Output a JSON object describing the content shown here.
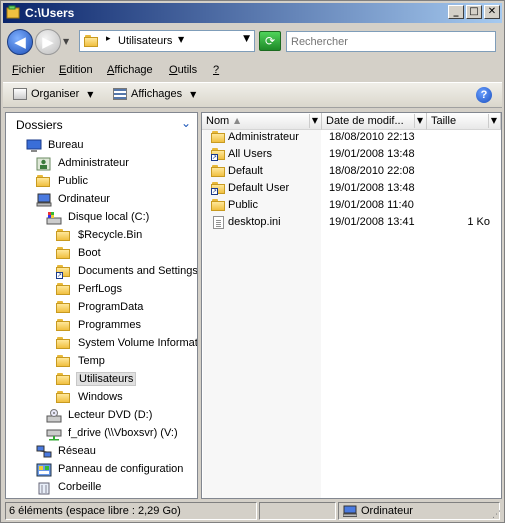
{
  "window": {
    "title": "C:\\Users"
  },
  "title_buttons": {
    "minimize": "_",
    "maximize": "□",
    "close": "✕"
  },
  "address": {
    "crumb": "Utilisateurs",
    "search_placeholder": "Rechercher"
  },
  "menu": [
    {
      "label": "Fichier",
      "accel": "F",
      "rest": "ichier"
    },
    {
      "label": "Edition",
      "accel": "E",
      "rest": "dition"
    },
    {
      "label": "Affichage",
      "accel": "A",
      "rest": "ffichage"
    },
    {
      "label": "Outils",
      "accel": "O",
      "rest": "utils"
    },
    {
      "label": "?",
      "accel": "?",
      "rest": ""
    }
  ],
  "toolbar": {
    "organize": "Organiser",
    "views": "Affichages"
  },
  "left_pane": {
    "header": "Dossiers",
    "tree": [
      {
        "label": "Bureau",
        "icon": "desktop-icon"
      },
      {
        "label": "Administrateur",
        "icon": "user-folder-icon"
      },
      {
        "label": "Public",
        "icon": "folder-icon"
      },
      {
        "label": "Ordinateur",
        "icon": "computer-icon"
      },
      {
        "label": "Disque local (C:)",
        "icon": "drive-icon"
      },
      {
        "label": "$Recycle.Bin",
        "icon": "folder-icon"
      },
      {
        "label": "Boot",
        "icon": "folder-icon"
      },
      {
        "label": "Documents and Settings",
        "icon": "folder-shortcut-icon"
      },
      {
        "label": "PerfLogs",
        "icon": "folder-icon"
      },
      {
        "label": "ProgramData",
        "icon": "folder-icon"
      },
      {
        "label": "Programmes",
        "icon": "folder-icon"
      },
      {
        "label": "System Volume Information",
        "icon": "folder-icon"
      },
      {
        "label": "Temp",
        "icon": "folder-icon"
      },
      {
        "label": "Utilisateurs",
        "icon": "folder-icon",
        "selected": true
      },
      {
        "label": "Windows",
        "icon": "folder-icon"
      },
      {
        "label": "Lecteur DVD (D:)",
        "icon": "dvd-icon"
      },
      {
        "label": "f_drive (\\\\Vboxsvr) (V:)",
        "icon": "network-drive-icon"
      },
      {
        "label": "Réseau",
        "icon": "network-icon"
      },
      {
        "label": "Panneau de configuration",
        "icon": "control-panel-icon"
      },
      {
        "label": "Corbeille",
        "icon": "recycle-bin-icon"
      }
    ]
  },
  "file_list": {
    "columns": [
      "Nom",
      "Date de modif...",
      "Taille"
    ],
    "rows": [
      {
        "name": "Administrateur",
        "date": "18/08/2010 22:13",
        "size": "",
        "icon": "folder-icon"
      },
      {
        "name": "All Users",
        "date": "19/01/2008 13:48",
        "size": "",
        "icon": "folder-shortcut-icon"
      },
      {
        "name": "Default",
        "date": "18/08/2010 22:08",
        "size": "",
        "icon": "folder-icon"
      },
      {
        "name": "Default User",
        "date": "19/01/2008 13:48",
        "size": "",
        "icon": "folder-shortcut-icon"
      },
      {
        "name": "Public",
        "date": "19/01/2008 11:40",
        "size": "",
        "icon": "folder-icon"
      },
      {
        "name": "desktop.ini",
        "date": "19/01/2008 13:41",
        "size": "1 Ko",
        "icon": "ini-file-icon"
      }
    ]
  },
  "status": {
    "items": "6 éléments (espace libre : 2,29 Go)",
    "location": "Ordinateur"
  },
  "colors": {
    "title_gradient_start": "#0a246a",
    "title_gradient_end": "#a6caf0",
    "chrome": "#d4d0c8"
  }
}
